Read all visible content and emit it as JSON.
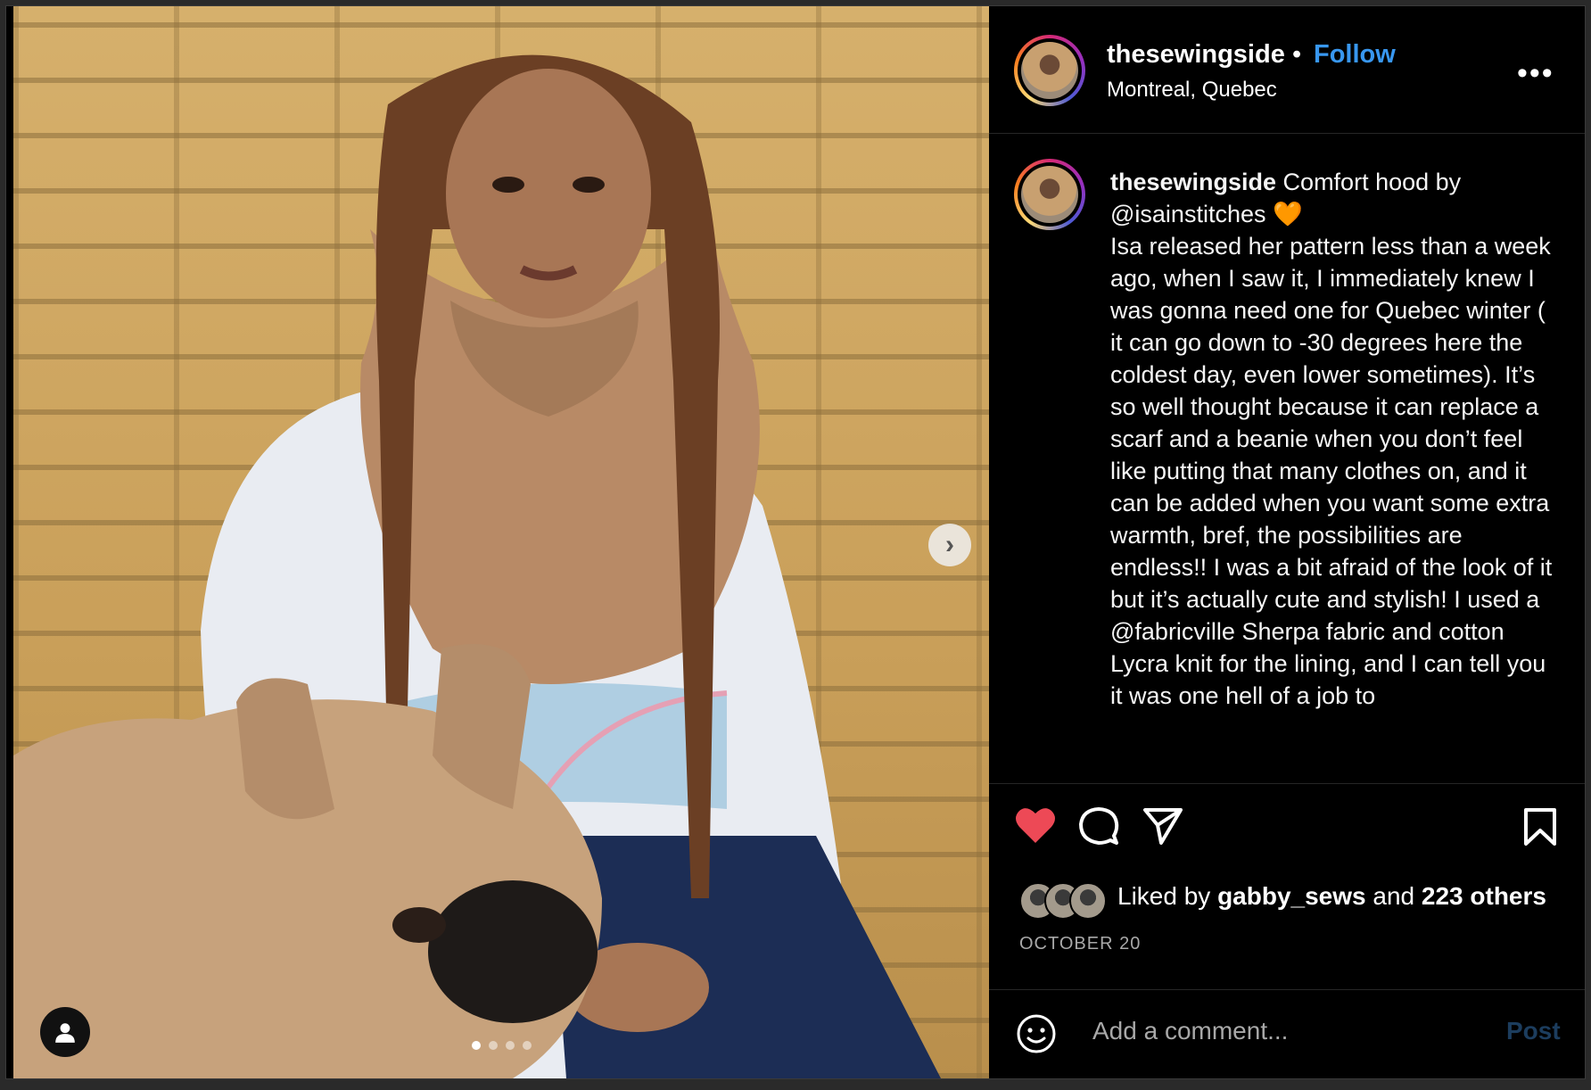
{
  "post": {
    "username": "thesewingside",
    "separator": "•",
    "follow_label": "Follow",
    "location": "Montreal, Quebec",
    "more_icon": "more-horizontal-icon",
    "more_label": "•••"
  },
  "caption": {
    "username": "thesewingside",
    "text_part1": " Comfort hood by",
    "mention1": "@isainstitches",
    "emoji": "🧡",
    "body1": "Isa released her pattern less than a week ago, when I saw it, I immediately knew I was gonna need one for Quebec winter ( it can go down to -30 degrees here the coldest day, even lower sometimes). It’s so well thought because it can replace a scarf and a beanie when you don’t feel like putting that many clothes on, and it can be added when you want some extra warmth, bref, the possibilities are endless!! I was a bit afraid of the look of it but it’s actually cute and stylish! I used a ",
    "mention2": "@fabricville",
    "body2": " Sherpa fabric and cotton Lycra knit for the lining, and I can tell you it was one hell of a job to"
  },
  "carousel": {
    "next_label": "›",
    "slide_count": 4,
    "active_slide": 1
  },
  "likes": {
    "prefix": "Liked by ",
    "first_liker": "gabby_sews",
    "middle": " and ",
    "others": "223 others"
  },
  "date": "OCTOBER 20",
  "comment": {
    "placeholder": "Add a comment...",
    "post_label": "Post"
  },
  "colors": {
    "like": "#ed4956",
    "follow": "#3897f0",
    "post_disabled": "#1c3d5e"
  }
}
